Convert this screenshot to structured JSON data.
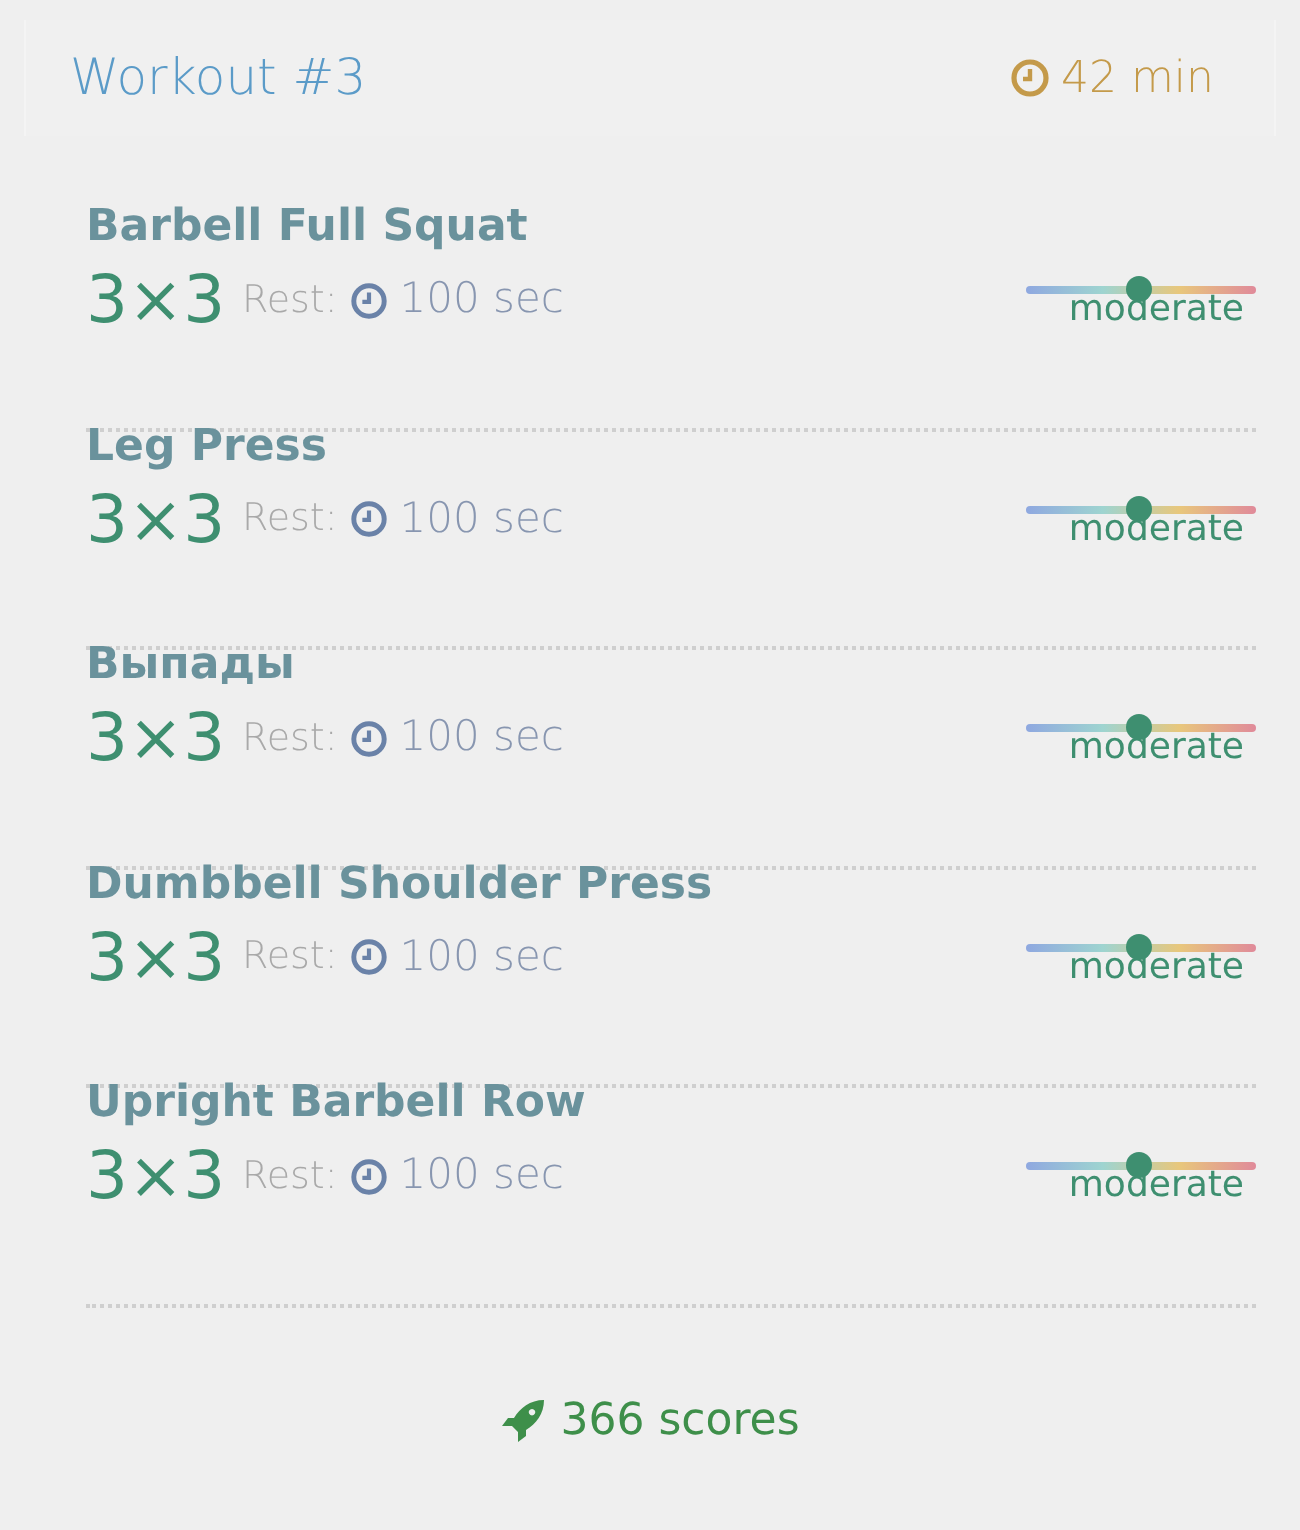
{
  "header": {
    "title": "Workout #3",
    "duration": "42 min"
  },
  "exercises": [
    {
      "name": "Barbell Full Squat",
      "sets": "3×3",
      "rest_label": "Rest:",
      "rest": "100 sec",
      "intensity": {
        "level": 0.49,
        "label": "moderate"
      }
    },
    {
      "name": "Leg Press",
      "sets": "3×3",
      "rest_label": "Rest:",
      "rest": "100 sec",
      "intensity": {
        "level": 0.49,
        "label": "moderate"
      }
    },
    {
      "name": "Выпады",
      "sets": "3×3",
      "rest_label": "Rest:",
      "rest": "100 sec",
      "intensity": {
        "level": 0.49,
        "label": "moderate"
      }
    },
    {
      "name": "Dumbbell Shoulder Press",
      "sets": "3×3",
      "rest_label": "Rest:",
      "rest": "100 sec",
      "intensity": {
        "level": 0.49,
        "label": "moderate"
      }
    },
    {
      "name": "Upright Barbell Row",
      "sets": "3×3",
      "rest_label": "Rest:",
      "rest": "100 sec",
      "intensity": {
        "level": 0.49,
        "label": "moderate"
      }
    }
  ],
  "footer": {
    "scores": "366 scores"
  }
}
